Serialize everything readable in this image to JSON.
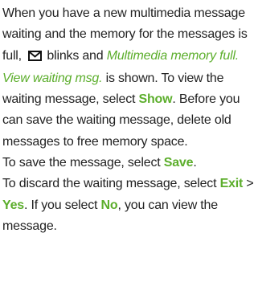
{
  "colors": {
    "text": "#222222",
    "accent_green": "#5cae2c"
  },
  "icons": {
    "message": "envelope-icon"
  },
  "paragraph1": {
    "t1": "When you have a new multimedia message waiting and the memory for the messages is full,",
    "t2": "blinks and",
    "note": "Multimedia memory full. View waiting msg.",
    "t3": "is shown. To view the waiting message, select",
    "show": "Show",
    "t4": ". Before you can save the waiting message, delete old messages to free memory space."
  },
  "paragraph2": {
    "t1": "To save the message, select",
    "save": "Save",
    "t2": "."
  },
  "paragraph3": {
    "t1": "To discard the waiting message, select",
    "exit": "Exit",
    "sep": ">",
    "yes": "Yes",
    "t2": ". If you select",
    "no": "No",
    "t3": ", you can view the message."
  }
}
